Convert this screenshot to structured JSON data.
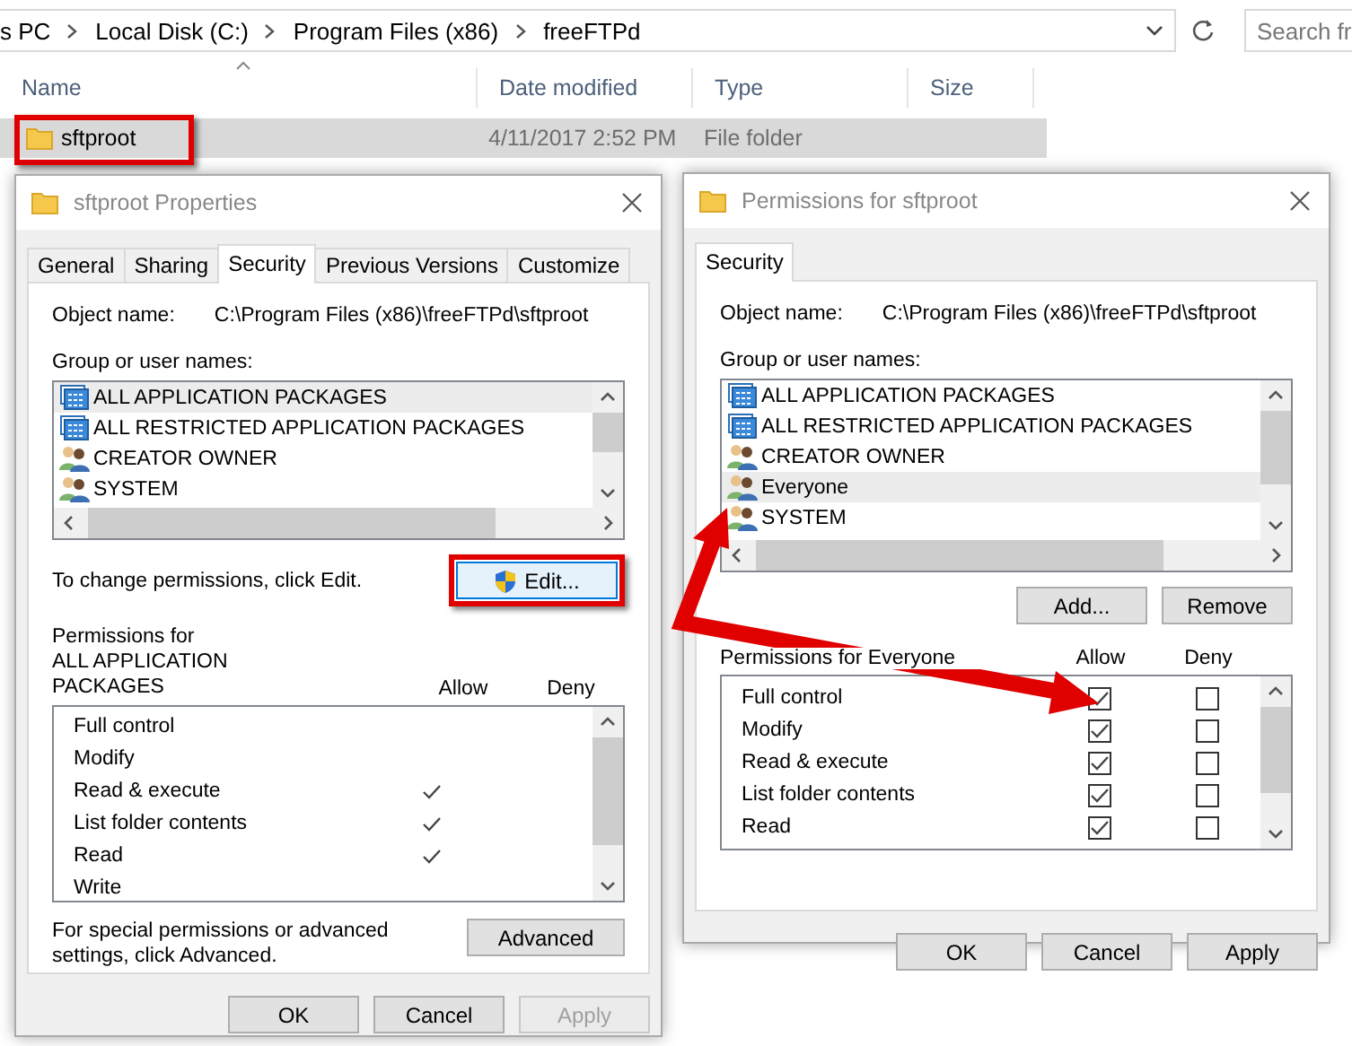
{
  "address_bar": {
    "breadcrumbs": [
      "s PC",
      "Local Disk (C:)",
      "Program Files (x86)",
      "freeFTPd"
    ],
    "search": {
      "placeholder": "Search fr"
    }
  },
  "file_list": {
    "columns": [
      "Name",
      "Date modified",
      "Type",
      "Size"
    ],
    "rows": [
      {
        "name": "sftproot",
        "date_modified": "4/11/2017 2:52 PM",
        "type": "File folder",
        "selected": true,
        "highlighted": true,
        "kind": "folder"
      }
    ]
  },
  "properties_window": {
    "title": "sftproot Properties",
    "tabs": [
      {
        "label": "General",
        "selected": false
      },
      {
        "label": "Sharing",
        "selected": false
      },
      {
        "label": "Security",
        "selected": true
      },
      {
        "label": "Previous Versions",
        "selected": false
      },
      {
        "label": "Customize",
        "selected": false
      }
    ],
    "object_name_label": "Object name:",
    "object_name": "C:\\Program Files (x86)\\freeFTPd\\sftproot",
    "group_label": "Group or user names:",
    "groups": [
      {
        "name": "ALL APPLICATION PACKAGES",
        "kind": "package",
        "selected": true
      },
      {
        "name": "ALL RESTRICTED APPLICATION PACKAGES",
        "kind": "package",
        "selected": false
      },
      {
        "name": "CREATOR OWNER",
        "kind": "users",
        "selected": false
      },
      {
        "name": "SYSTEM",
        "kind": "users",
        "selected": false
      }
    ],
    "edit_hint": "To change permissions, click Edit.",
    "edit_button": {
      "label": "Edit...",
      "highlighted": true
    },
    "permissions_label": "Permissions for ALL APPLICATION PACKAGES",
    "allow_header": "Allow",
    "deny_header": "Deny",
    "permissions": [
      {
        "name": "Full control",
        "allow": false,
        "deny": false
      },
      {
        "name": "Modify",
        "allow": false,
        "deny": false
      },
      {
        "name": "Read & execute",
        "allow": true,
        "deny": false
      },
      {
        "name": "List folder contents",
        "allow": true,
        "deny": false
      },
      {
        "name": "Read",
        "allow": true,
        "deny": false
      },
      {
        "name": "Write",
        "allow": false,
        "deny": false
      }
    ],
    "advanced_hint": "For special permissions or advanced settings, click Advanced.",
    "advanced_button": "Advanced",
    "buttons": [
      {
        "label": "OK",
        "disabled": false
      },
      {
        "label": "Cancel",
        "disabled": false
      },
      {
        "label": "Apply",
        "disabled": true
      }
    ]
  },
  "permissions_dialog": {
    "title": "Permissions for sftproot",
    "tabs": [
      {
        "label": "Security",
        "selected": true
      }
    ],
    "object_name_label": "Object name:",
    "object_name": "C:\\Program Files (x86)\\freeFTPd\\sftproot",
    "group_label": "Group or user names:",
    "groups": [
      {
        "name": "ALL APPLICATION PACKAGES",
        "kind": "package",
        "selected": false
      },
      {
        "name": "ALL RESTRICTED APPLICATION PACKAGES",
        "kind": "package",
        "selected": false
      },
      {
        "name": "CREATOR OWNER",
        "kind": "users",
        "selected": false
      },
      {
        "name": "Everyone",
        "kind": "users",
        "selected": true
      },
      {
        "name": "SYSTEM",
        "kind": "users",
        "selected": false
      }
    ],
    "add_button": "Add...",
    "remove_button": "Remove",
    "permissions_label": "Permissions for Everyone",
    "allow_header": "Allow",
    "deny_header": "Deny",
    "permissions": [
      {
        "name": "Full control",
        "allow": true,
        "deny": false
      },
      {
        "name": "Modify",
        "allow": true,
        "deny": false
      },
      {
        "name": "Read & execute",
        "allow": true,
        "deny": false
      },
      {
        "name": "List folder contents",
        "allow": true,
        "deny": false
      },
      {
        "name": "Read",
        "allow": true,
        "deny": false
      }
    ],
    "buttons": [
      {
        "label": "OK",
        "disabled": false
      },
      {
        "label": "Cancel",
        "disabled": false
      },
      {
        "label": "Apply",
        "disabled": false
      }
    ]
  }
}
